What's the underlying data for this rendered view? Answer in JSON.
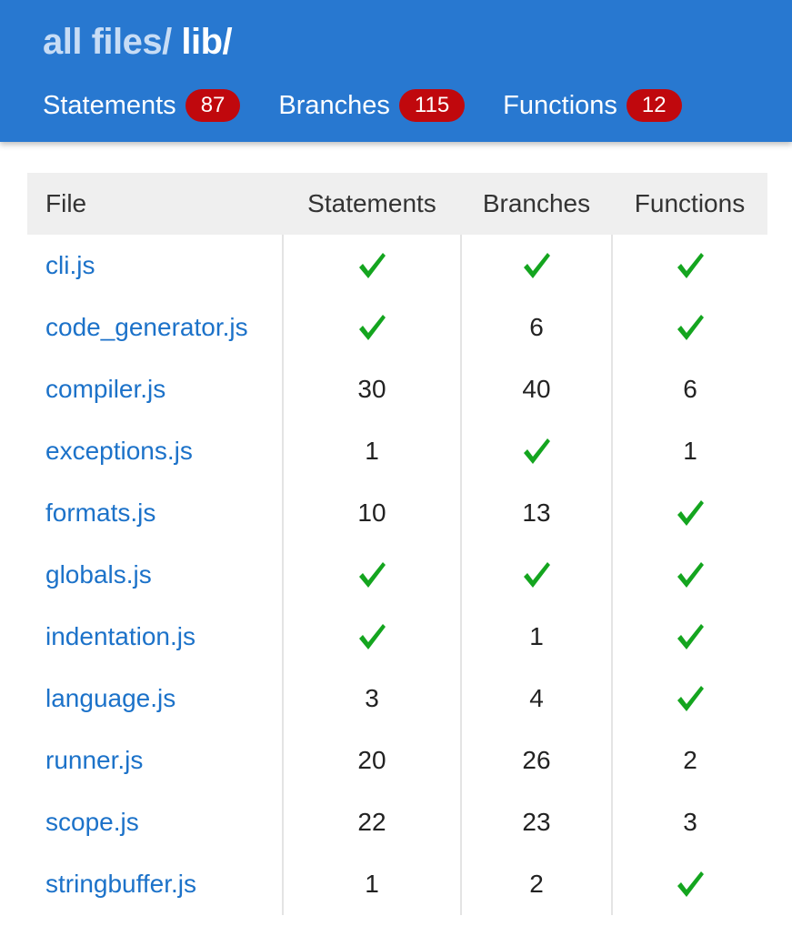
{
  "breadcrumb": {
    "root": "all files",
    "separator": "/",
    "current": "lib/"
  },
  "summary": [
    {
      "label": "Statements",
      "count": "87"
    },
    {
      "label": "Branches",
      "count": "115"
    },
    {
      "label": "Functions",
      "count": "12"
    }
  ],
  "columns": [
    "File",
    "Statements",
    "Branches",
    "Functions"
  ],
  "rows": [
    {
      "file": "cli.js",
      "statements": "✓",
      "branches": "✓",
      "functions": "✓"
    },
    {
      "file": "code_generator.js",
      "statements": "✓",
      "branches": "6",
      "functions": "✓"
    },
    {
      "file": "compiler.js",
      "statements": "30",
      "branches": "40",
      "functions": "6"
    },
    {
      "file": "exceptions.js",
      "statements": "1",
      "branches": "✓",
      "functions": "1"
    },
    {
      "file": "formats.js",
      "statements": "10",
      "branches": "13",
      "functions": "✓"
    },
    {
      "file": "globals.js",
      "statements": "✓",
      "branches": "✓",
      "functions": "✓"
    },
    {
      "file": "indentation.js",
      "statements": "✓",
      "branches": "1",
      "functions": "✓"
    },
    {
      "file": "language.js",
      "statements": "3",
      "branches": "4",
      "functions": "✓"
    },
    {
      "file": "runner.js",
      "statements": "20",
      "branches": "26",
      "functions": "2"
    },
    {
      "file": "scope.js",
      "statements": "22",
      "branches": "23",
      "functions": "3"
    },
    {
      "file": "stringbuffer.js",
      "statements": "1",
      "branches": "2",
      "functions": "✓"
    }
  ],
  "colors": {
    "header_bg": "#2878d0",
    "badge_bg": "#c0080d",
    "link": "#1c72c9",
    "check": "#14a51f",
    "table_header_bg": "#efefef"
  },
  "icons": {
    "covered": "check-icon"
  }
}
